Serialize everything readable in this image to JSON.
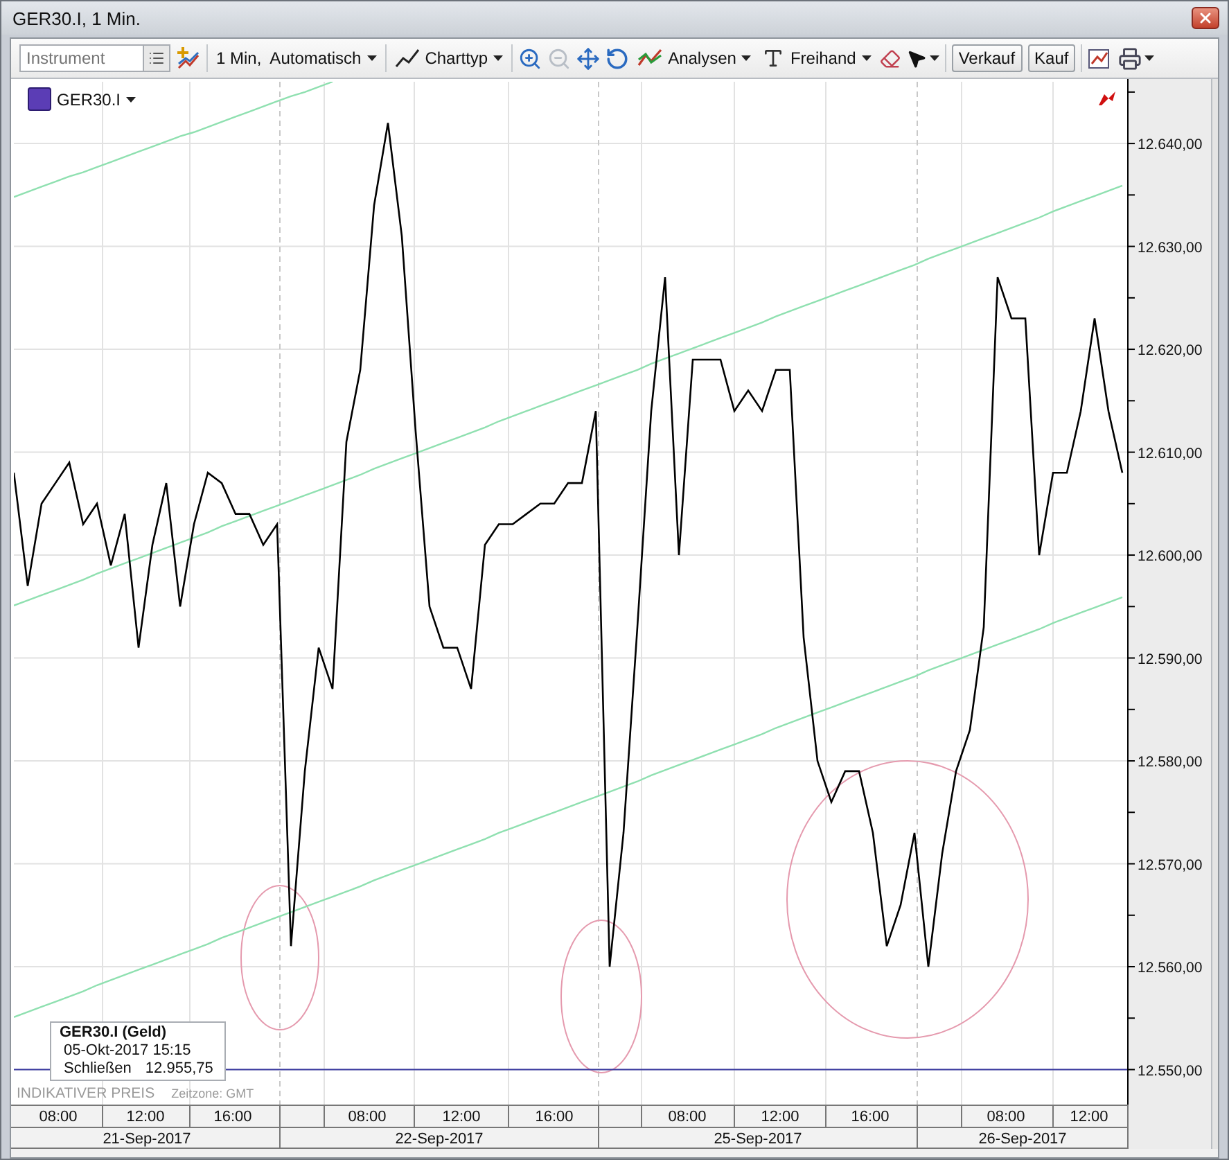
{
  "window": {
    "title": "GER30.I, 1 Min."
  },
  "toolbar": {
    "instrument_field": {
      "placeholder": "Instrument"
    },
    "interval_menu": {
      "label": "1 Min,  Automatisch"
    },
    "chart_type_menu": {
      "label": "Charttyp"
    },
    "zoom_out": {
      "disabled": true
    },
    "analyses_menu": {
      "label": "Analysen"
    },
    "freehand_menu": {
      "label": "Freihand"
    },
    "sell_button": {
      "label": "Verkauf"
    },
    "buy_button": {
      "label": "Kauf"
    }
  },
  "chart": {
    "info_box": {
      "title": "GER30.I (Geld)",
      "datetime": "05-Okt-2017 15:15",
      "close_label": "Schließen",
      "close_value": "12.955,75"
    },
    "footer": {
      "price_note": "INDIKATIVER PREIS",
      "timezone": "Zeitzone: GMT"
    },
    "hours": [
      "08:00",
      "12:00",
      "16:00",
      "08:00",
      "12:00",
      "16:00",
      "08:00",
      "12:00",
      "16:00",
      "08:00",
      "12:00"
    ],
    "days": [
      "21-Sep-2017",
      "22-Sep-2017",
      "25-Sep-2017",
      "26-Sep-2017"
    ],
    "drawings": [
      {
        "kind": "circle"
      },
      {
        "kind": "circle"
      },
      {
        "kind": "circle"
      }
    ],
    "chart_data": {
      "type": "line",
      "grid": true,
      "ylim": [
        12546.6,
        12646
      ],
      "ref_lines": [
        {
          "axis": "y",
          "value": 12550,
          "color": "#3b3ba0"
        }
      ],
      "categories": [
        null,
        null,
        null,
        null,
        null,
        null,
        null,
        null,
        null,
        null,
        null,
        null,
        null,
        null,
        null,
        null,
        null,
        null,
        null,
        null,
        null,
        null,
        null,
        null,
        null,
        null,
        null,
        null,
        null,
        null,
        null,
        null,
        null,
        null,
        null,
        null,
        null,
        null,
        null,
        null,
        null,
        null,
        null,
        null,
        null,
        null,
        null,
        null,
        null,
        null,
        null,
        null,
        null,
        null,
        null,
        null,
        null,
        null,
        null,
        null,
        null,
        null,
        null,
        null,
        null,
        null,
        null,
        null,
        null,
        null,
        null,
        null,
        null,
        null,
        null,
        null,
        null,
        null,
        null,
        null,
        null
      ],
      "series": [
        {
          "name": "GER30.I",
          "color": "#000000",
          "values": [
            12608,
            12597,
            12605,
            12607,
            12609,
            12603,
            12605,
            12599,
            12604,
            12591,
            12601,
            12607,
            12595,
            12603,
            12608,
            12607,
            12604,
            12604,
            12601,
            12603,
            12562,
            12579,
            12591,
            12587,
            12611,
            12618,
            12634,
            12642,
            12631,
            12612,
            12595,
            12591,
            12591,
            12587,
            12601,
            12603,
            12603,
            12604,
            12605,
            12605,
            12607,
            12607,
            12614,
            12560,
            12573,
            12593,
            12614,
            12627,
            12600,
            12619,
            12619,
            12619,
            12614,
            12616,
            12614,
            12618,
            12618,
            12592,
            12580,
            12576,
            12579,
            12579,
            12573,
            12562,
            12566,
            12573,
            12560,
            12571,
            12579,
            12583,
            12593,
            12627,
            12623,
            12623,
            12600,
            12608,
            12608,
            12614,
            12623,
            12614,
            12608
          ]
        },
        {
          "color": "#8fe0b0",
          "values": [
            12634.8,
            12635.3,
            12635.8,
            12636.3,
            12636.8,
            12637.2,
            12637.7,
            12638.2,
            12638.7,
            12639.2,
            12639.7,
            12640.2,
            12640.7,
            12641.1,
            12641.6,
            12642.1,
            12642.6,
            12643.1,
            12643.6,
            12644.1,
            12644.6,
            12645.0,
            12645.5,
            12646.0,
            null,
            null,
            null,
            null,
            null,
            null,
            null,
            null,
            null,
            null,
            null,
            null,
            null,
            null,
            null,
            null,
            null,
            null,
            null,
            null,
            null,
            null,
            null,
            null,
            null,
            null,
            null,
            null,
            null,
            null,
            null,
            null,
            null,
            null,
            null,
            null,
            null,
            null,
            null,
            null,
            null,
            null,
            null,
            null,
            null,
            null,
            null,
            null,
            null,
            null,
            null,
            null,
            null,
            null,
            null,
            null,
            null
          ]
        },
        {
          "color": "#8fe0b0",
          "values": [
            12595.1,
            12595.6,
            12596.1,
            12596.6,
            12597.1,
            12597.6,
            12598.2,
            12598.7,
            12599.2,
            12599.7,
            12600.2,
            12600.7,
            12601.2,
            12601.7,
            12602.2,
            12602.8,
            12603.3,
            12603.8,
            12604.3,
            12604.8,
            12605.3,
            12605.8,
            12606.3,
            12606.8,
            12607.3,
            12607.8,
            12608.4,
            12608.9,
            12609.4,
            12609.9,
            12610.4,
            12610.9,
            12611.4,
            12611.9,
            12612.4,
            12613.0,
            12613.5,
            12614.0,
            12614.5,
            12615.0,
            12615.5,
            12616.0,
            12616.5,
            12617.0,
            12617.5,
            12618.0,
            12618.6,
            12619.1,
            12619.6,
            12620.1,
            12620.6,
            12621.1,
            12621.6,
            12622.1,
            12622.6,
            12623.2,
            12623.7,
            12624.2,
            12624.7,
            12625.2,
            12625.7,
            12626.2,
            12626.7,
            12627.2,
            12627.7,
            12628.2,
            12628.8,
            12629.3,
            12629.8,
            12630.3,
            12630.8,
            12631.3,
            12631.8,
            12632.3,
            12632.8,
            12633.4,
            12633.9,
            12634.4,
            12634.9,
            12635.4,
            12635.9
          ]
        },
        {
          "color": "#8fe0b0",
          "values": [
            12555.1,
            12555.6,
            12556.1,
            12556.6,
            12557.1,
            12557.6,
            12558.2,
            12558.7,
            12559.2,
            12559.7,
            12560.2,
            12560.7,
            12561.2,
            12561.7,
            12562.2,
            12562.8,
            12563.3,
            12563.8,
            12564.3,
            12564.8,
            12565.3,
            12565.8,
            12566.3,
            12566.8,
            12567.3,
            12567.8,
            12568.4,
            12568.9,
            12569.4,
            12569.9,
            12570.4,
            12570.9,
            12571.4,
            12571.9,
            12572.4,
            12573.0,
            12573.5,
            12574.0,
            12574.5,
            12575.0,
            12575.5,
            12576.0,
            12576.5,
            12577.0,
            12577.5,
            12578.0,
            12578.6,
            12579.1,
            12579.6,
            12580.1,
            12580.6,
            12581.1,
            12581.6,
            12582.1,
            12582.6,
            12583.2,
            12583.7,
            12584.2,
            12584.7,
            12585.2,
            12585.7,
            12586.2,
            12586.7,
            12587.2,
            12587.7,
            12588.2,
            12588.8,
            12589.3,
            12589.8,
            12590.3,
            12590.8,
            12591.3,
            12591.8,
            12592.3,
            12592.8,
            12593.4,
            12593.9,
            12594.4,
            12594.9,
            12595.4,
            12595.9
          ]
        }
      ],
      "yticks": [
        {
          "value": 12550,
          "label": "12.550,00"
        },
        {
          "value": 12560,
          "label": "12.560,00"
        },
        {
          "value": 12570,
          "label": "12.570,00"
        },
        {
          "value": 12580,
          "label": "12.580,00"
        },
        {
          "value": 12590,
          "label": "12.590,00"
        },
        {
          "value": 12600,
          "label": "12.600,00"
        },
        {
          "value": 12610,
          "label": "12.610,00"
        },
        {
          "value": 12620,
          "label": "12.620,00"
        },
        {
          "value": 12630,
          "label": "12.630,00"
        },
        {
          "value": 12640,
          "label": "12.640,00"
        }
      ]
    }
  }
}
